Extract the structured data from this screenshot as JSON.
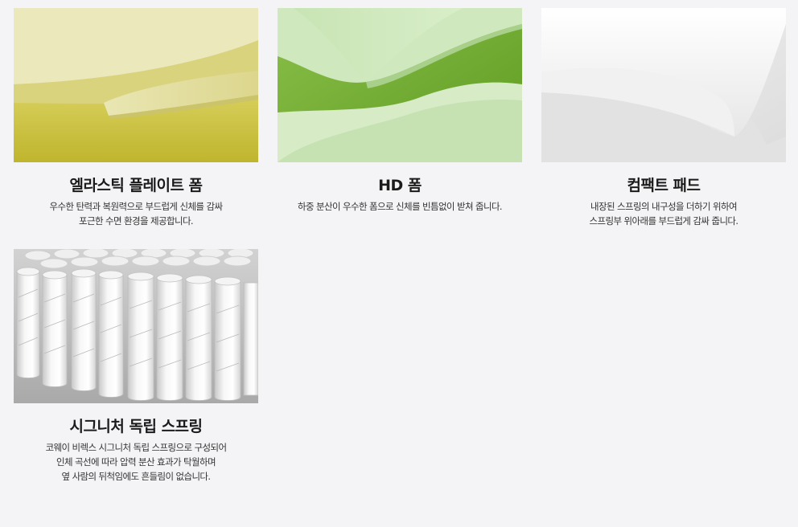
{
  "products": [
    {
      "title": "엘라스틱 플레이트 폼",
      "image": "elastic-plate-foam-image",
      "lines": [
        "우수한 탄력과 복원력으로 부드럽게 신체를 감싸",
        "포근한 수면 환경을 제공합니다."
      ]
    },
    {
      "title": "HD 폼",
      "image": "hd-foam-image",
      "lines": [
        "하중 분산이 우수한 폼으로 신체를 빈틈없이 받쳐 줍니다."
      ]
    },
    {
      "title": "컴팩트 패드",
      "image": "compact-pad-image",
      "lines": [
        "내장된 스프링의 내구성을 더하기 위하여",
        "스프링부 위아래를 부드럽게 감싸 줍니다."
      ]
    },
    {
      "title": "시그니처 독립 스프링",
      "image": "signature-pocket-spring-image",
      "lines": [
        "코웨이 비렉스 시그니처 독립 스프링으로 구성되어",
        "인체 곡선에 따라 압력 분산 효과가 탁월하며",
        "옆 사람의 뒤척임에도 흔들림이 없습니다."
      ]
    }
  ],
  "colors": {
    "background": "#f4f4f7",
    "elastic_foam": "#d7d27a",
    "hd_foam_light": "#cfe9bf",
    "hd_foam_dark": "#6aa52a",
    "compact_pad": "#ececec",
    "spring_bg": "#bdbdbd"
  }
}
